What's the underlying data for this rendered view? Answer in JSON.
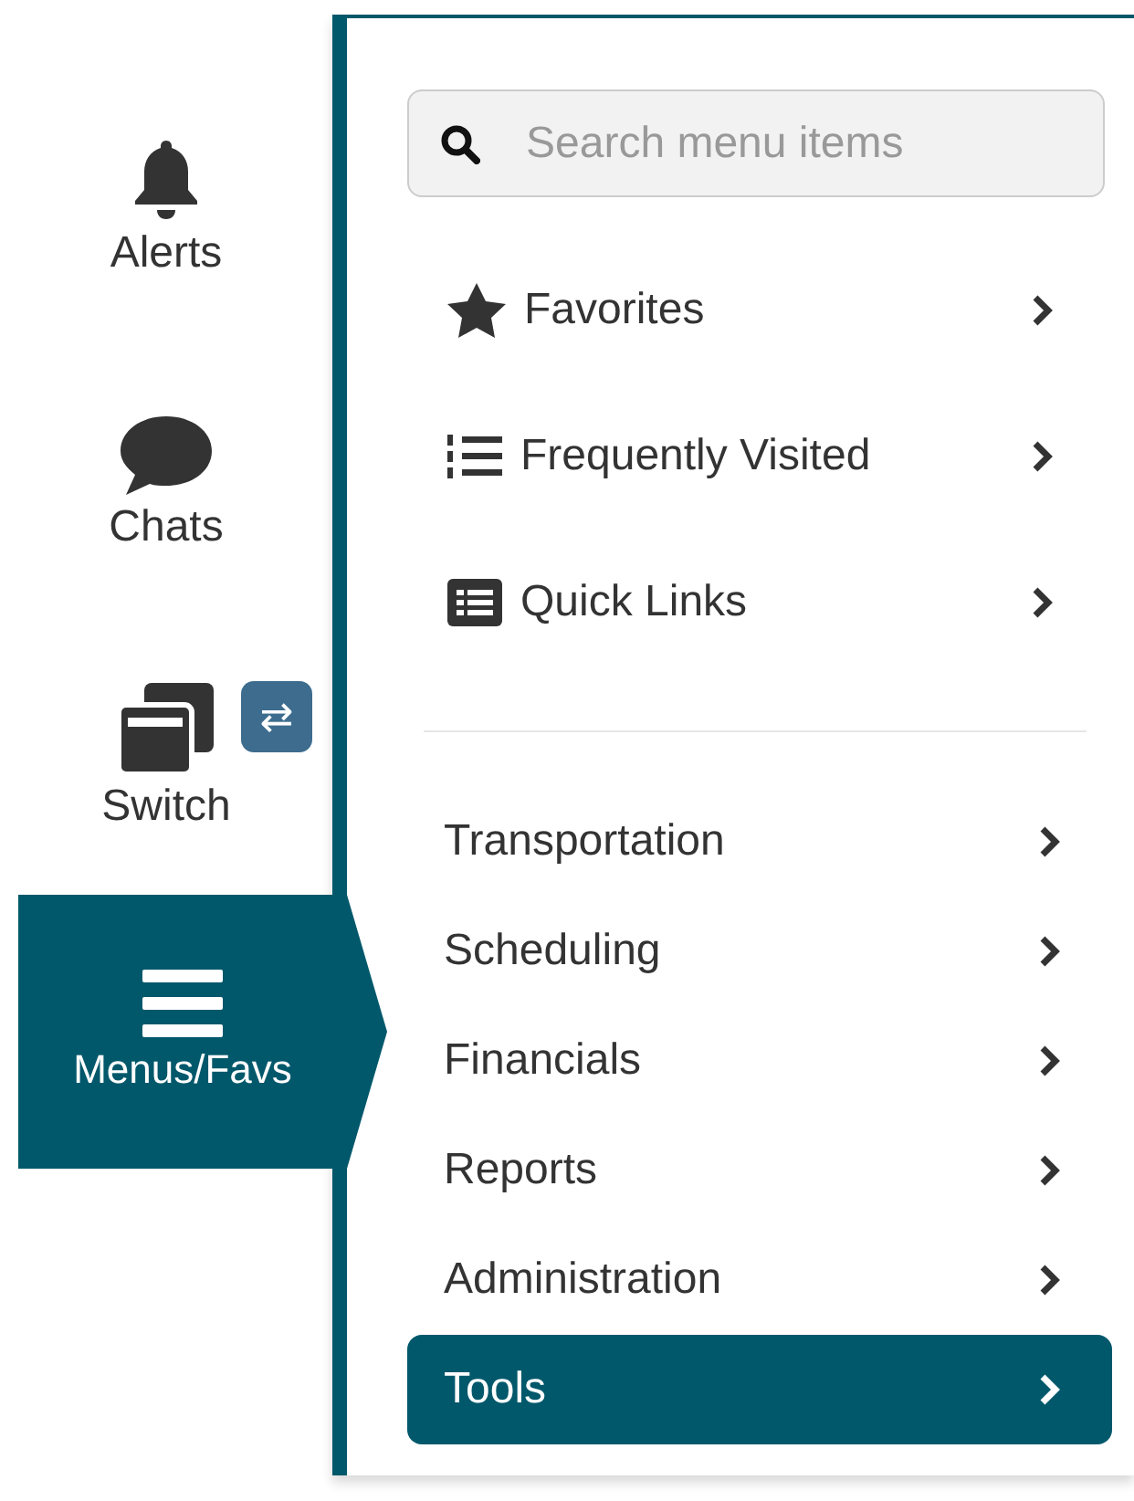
{
  "sidebar": {
    "items": [
      {
        "label": "Alerts",
        "selected": false
      },
      {
        "label": "Chats",
        "selected": false
      },
      {
        "label": "Switch",
        "selected": false,
        "badge": "⇄"
      },
      {
        "label": "Menus/Favs",
        "selected": true
      }
    ]
  },
  "search": {
    "placeholder": "Search menu items"
  },
  "quick_items": [
    {
      "label": "Favorites"
    },
    {
      "label": "Frequently Visited"
    },
    {
      "label": "Quick Links"
    }
  ],
  "menu_items": [
    {
      "label": "Transportation",
      "selected": false
    },
    {
      "label": "Scheduling",
      "selected": false
    },
    {
      "label": "Financials",
      "selected": false
    },
    {
      "label": "Reports",
      "selected": false
    },
    {
      "label": "Administration",
      "selected": false
    },
    {
      "label": "Tools",
      "selected": true
    }
  ]
}
